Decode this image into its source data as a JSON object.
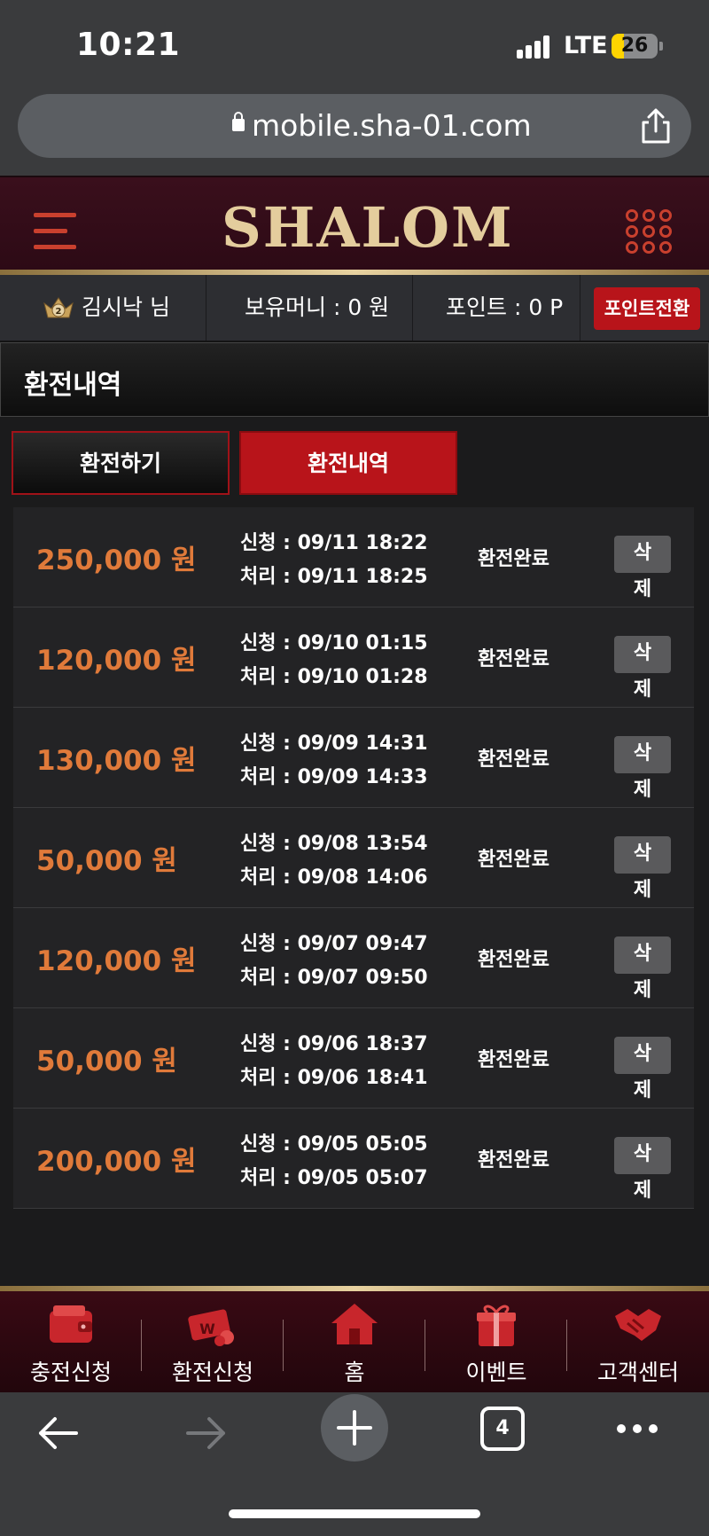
{
  "status_bar": {
    "time": "10:21",
    "network": "LTE",
    "battery": "26",
    "battery_level": 0.26
  },
  "browser": {
    "url": "mobile.sha-01.com",
    "tabs_count": "4"
  },
  "site": {
    "logo": "SHALOM",
    "user": {
      "name": "김시낙 님",
      "level": "2",
      "money": "보유머니 : 0 원",
      "points": "포인트 : 0 P",
      "convert_button": "포인트전환"
    }
  },
  "page": {
    "title": "환전내역",
    "tabs": [
      {
        "label": "환전하기",
        "active": false
      },
      {
        "label": "환전내역",
        "active": true
      }
    ]
  },
  "history": [
    {
      "amount": "250,000 원",
      "request": "신청 : 09/11 18:22",
      "processed": "처리 : 09/11 18:25",
      "status": "환전완료",
      "delete_top": "삭",
      "delete_bottom": "제"
    },
    {
      "amount": "120,000 원",
      "request": "신청 : 09/10 01:15",
      "processed": "처리 : 09/10 01:28",
      "status": "환전완료",
      "delete_top": "삭",
      "delete_bottom": "제"
    },
    {
      "amount": "130,000 원",
      "request": "신청 : 09/09 14:31",
      "processed": "처리 : 09/09 14:33",
      "status": "환전완료",
      "delete_top": "삭",
      "delete_bottom": "제"
    },
    {
      "amount": "50,000 원",
      "request": "신청 : 09/08 13:54",
      "processed": "처리 : 09/08 14:06",
      "status": "환전완료",
      "delete_top": "삭",
      "delete_bottom": "제"
    },
    {
      "amount": "120,000 원",
      "request": "신청 : 09/07 09:47",
      "processed": "처리 : 09/07 09:50",
      "status": "환전완료",
      "delete_top": "삭",
      "delete_bottom": "제"
    },
    {
      "amount": "50,000 원",
      "request": "신청 : 09/06 18:37",
      "processed": "처리 : 09/06 18:41",
      "status": "환전완료",
      "delete_top": "삭",
      "delete_bottom": "제"
    },
    {
      "amount": "200,000 원",
      "request": "신청 : 09/05 05:05",
      "processed": "처리 : 09/05 05:07",
      "status": "환전완료",
      "delete_top": "삭",
      "delete_bottom": "제"
    }
  ],
  "bottom_nav": [
    {
      "label": "충전신청",
      "icon": "wallet-icon"
    },
    {
      "label": "환전신청",
      "icon": "money-icon"
    },
    {
      "label": "홈",
      "icon": "home-icon"
    },
    {
      "label": "이벤트",
      "icon": "gift-icon"
    },
    {
      "label": "고객센터",
      "icon": "handshake-icon"
    }
  ],
  "colors": {
    "accent_red": "#b8141a",
    "amount_orange": "#e07a3a",
    "gold": "#e4cd9d",
    "header_maroon": "#3a0f1c"
  }
}
